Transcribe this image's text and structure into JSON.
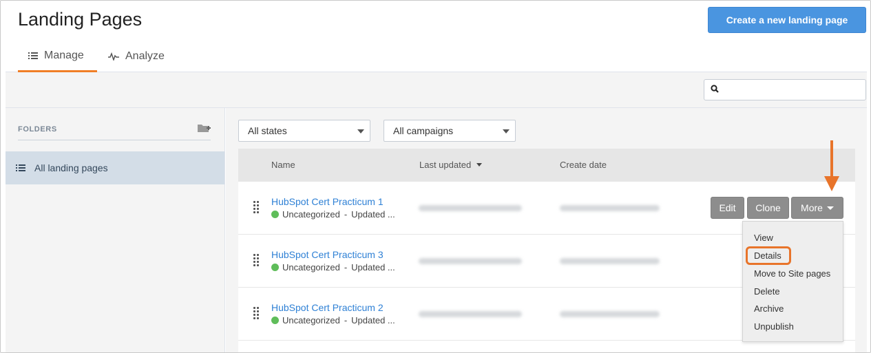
{
  "header": {
    "title": "Landing Pages",
    "create_button": "Create a new landing page",
    "tabs": [
      {
        "label": "Manage",
        "icon": "list-icon",
        "active": true
      },
      {
        "label": "Analyze",
        "icon": "pulse-icon",
        "active": false
      }
    ]
  },
  "toolbar": {
    "search_placeholder": ""
  },
  "sidebar": {
    "folders_label": "FOLDERS",
    "items": [
      {
        "label": "All landing pages",
        "icon": "list-icon",
        "selected": true
      }
    ]
  },
  "filters": {
    "states": "All states",
    "campaigns": "All campaigns"
  },
  "table": {
    "columns": [
      "Name",
      "Last updated",
      "Create date"
    ],
    "sorted_column": "Last updated",
    "rows": [
      {
        "title": "HubSpot Cert Practicum 1",
        "folder": "Uncategorized",
        "separator": "-",
        "updated": "Updated ..."
      },
      {
        "title": "HubSpot Cert Practicum 3",
        "folder": "Uncategorized",
        "separator": "-",
        "updated": "Updated ..."
      },
      {
        "title": "HubSpot Cert Practicum 2",
        "folder": "Uncategorized",
        "separator": "-",
        "updated": "Updated ..."
      }
    ],
    "actions": {
      "edit": "Edit",
      "clone": "Clone",
      "more": "More"
    }
  },
  "more_menu": {
    "items": [
      "View",
      "Details",
      "Move to Site pages",
      "Delete",
      "Archive",
      "Unpublish"
    ],
    "highlighted": "Details"
  },
  "colors": {
    "accent": "#f07e26",
    "primary_button": "#4a95e0",
    "link": "#2e80d5",
    "status_published": "#5fbd5a"
  }
}
